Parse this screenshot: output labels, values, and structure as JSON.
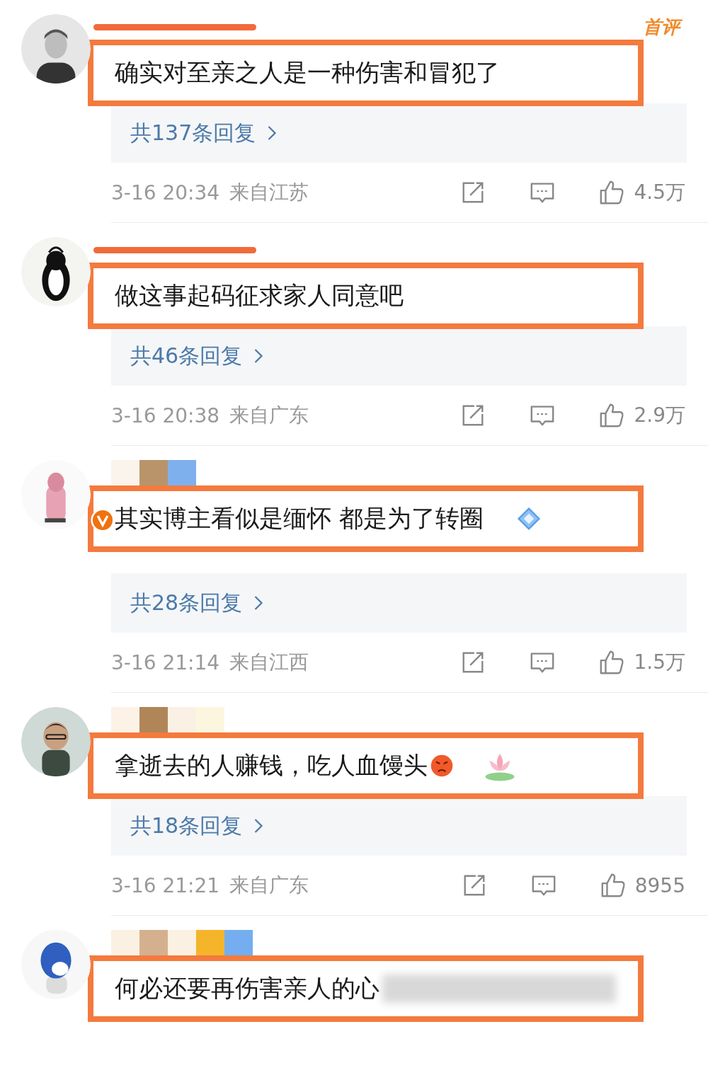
{
  "comments": [
    {
      "name_mask": {
        "kind": "strike",
        "tiles": [
          {
            "color": "#f26a3a"
          }
        ]
      },
      "badge": "首评",
      "verified": false,
      "text": "确实对至亲之人是一种伤害和冒犯了",
      "replies": "共137条回复",
      "time": "3-16 20:34",
      "location": "来自江苏",
      "likes": "4.5万"
    },
    {
      "name_mask": {
        "kind": "strike",
        "tiles": [
          {
            "color": "#f26a3a"
          }
        ]
      },
      "verified": false,
      "text": "做这事起码征求家人同意吧",
      "replies": "共46条回复",
      "time": "3-16 20:38",
      "location": "来自广东",
      "likes": "2.9万"
    },
    {
      "name_mask": {
        "kind": "mosaic",
        "tiles": [
          {
            "color": "#fbf4ec"
          },
          {
            "color": "#b9946a"
          },
          {
            "color": "#7fb0ee"
          }
        ]
      },
      "verified": true,
      "text": "其实博主看似是缅怀 都是为了转圈",
      "stickers": [
        {
          "kind": "diamond"
        }
      ],
      "replies": "共28条回复",
      "time": "3-16 21:14",
      "location": "来自江西",
      "likes": "1.5万"
    },
    {
      "name_mask": {
        "kind": "mosaic",
        "tiles": [
          {
            "color": "#fcf2e6"
          },
          {
            "color": "#b08658"
          },
          {
            "color": "#fbf0e4"
          },
          {
            "color": "#fdf6df"
          }
        ]
      },
      "verified": false,
      "text": "拿逝去的人赚钱，吃人血馒头",
      "emojis": [
        {
          "kind": "angry"
        }
      ],
      "stickers": [
        {
          "kind": "lotus"
        }
      ],
      "replies": "共18条回复",
      "time": "3-16 21:21",
      "location": "来自广东",
      "likes": "8955"
    },
    {
      "name_mask": {
        "kind": "mosaic",
        "tiles": [
          {
            "color": "#fbf1e2"
          },
          {
            "color": "#d4b08f"
          },
          {
            "color": "#fbf1e2"
          },
          {
            "color": "#f5b52a"
          },
          {
            "color": "#74aef0"
          }
        ]
      },
      "verified": false,
      "text": "何必还要再伤害亲人的心",
      "blurred_tail": true
    }
  ]
}
